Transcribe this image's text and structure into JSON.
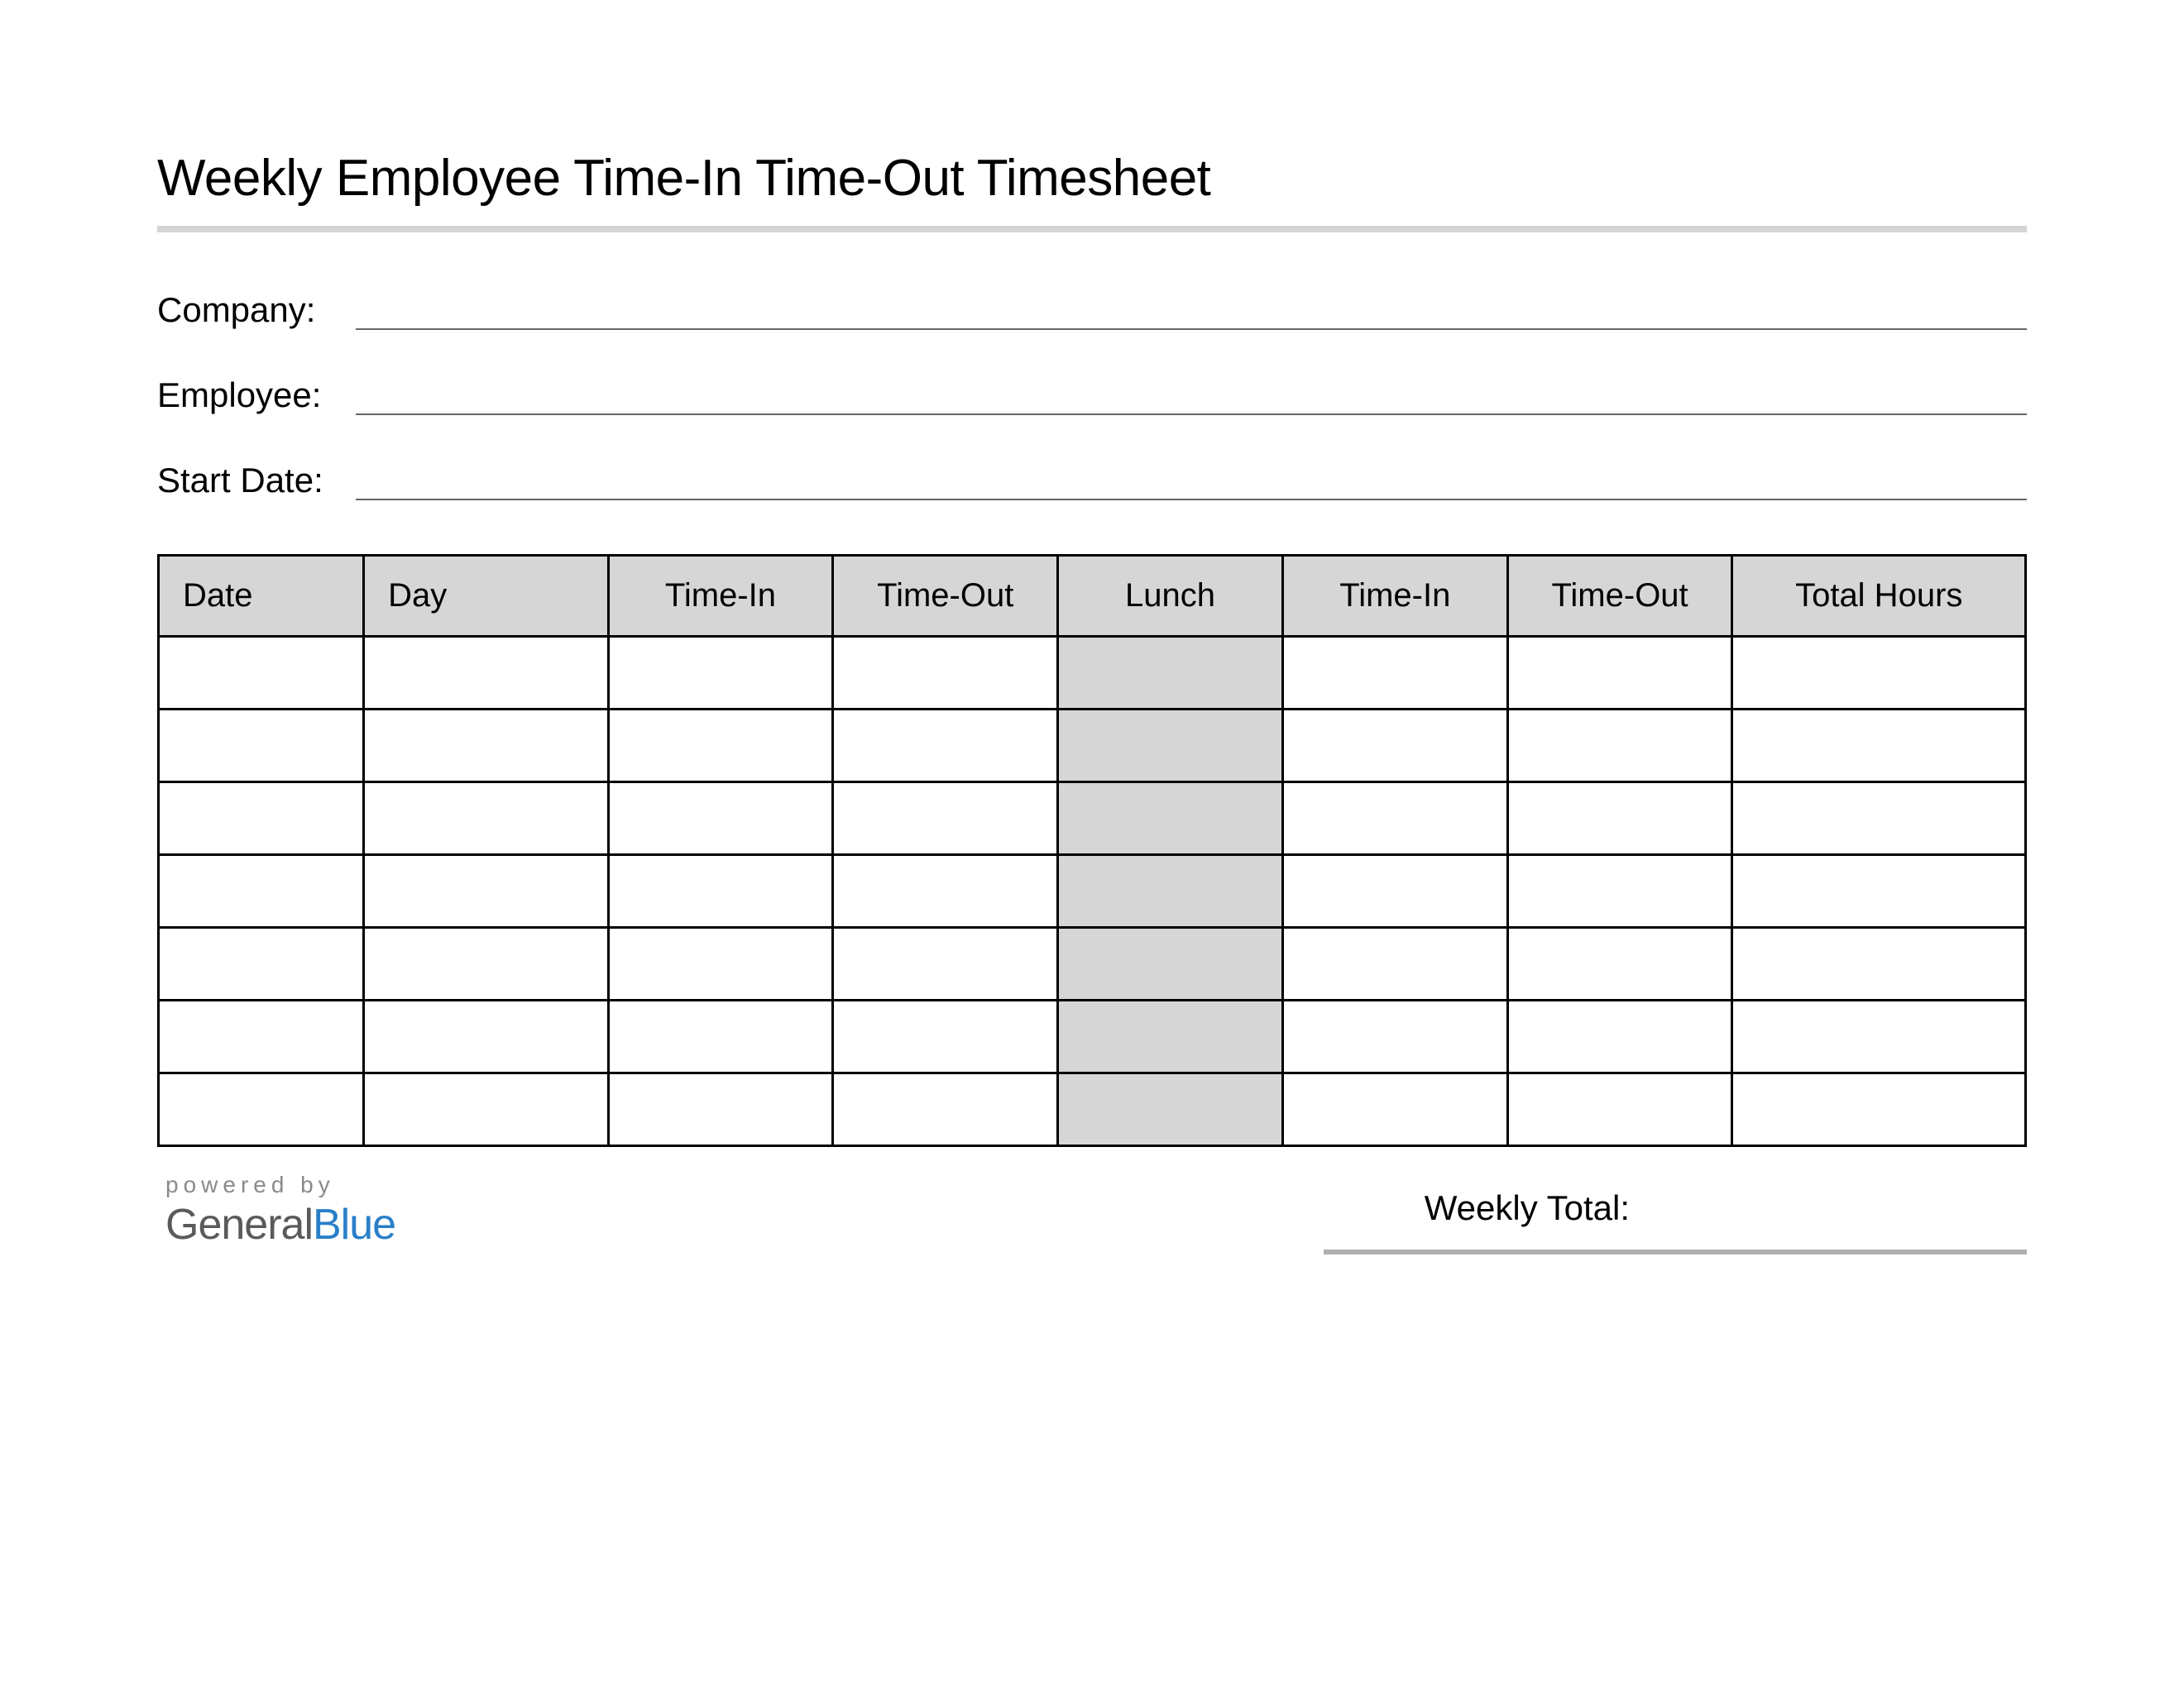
{
  "title": "Weekly Employee Time-In Time-Out Timesheet",
  "fields": {
    "company_label": "Company:",
    "employee_label": "Employee:",
    "start_date_label": "Start Date:",
    "company_value": "",
    "employee_value": "",
    "start_date_value": ""
  },
  "table": {
    "headers": [
      "Date",
      "Day",
      "Time-In",
      "Time-Out",
      "Lunch",
      "Time-In",
      "Time-Out",
      "Total Hours"
    ],
    "rows": [
      [
        "",
        "",
        "",
        "",
        "",
        "",
        "",
        ""
      ],
      [
        "",
        "",
        "",
        "",
        "",
        "",
        "",
        ""
      ],
      [
        "",
        "",
        "",
        "",
        "",
        "",
        "",
        ""
      ],
      [
        "",
        "",
        "",
        "",
        "",
        "",
        "",
        ""
      ],
      [
        "",
        "",
        "",
        "",
        "",
        "",
        "",
        ""
      ],
      [
        "",
        "",
        "",
        "",
        "",
        "",
        "",
        ""
      ],
      [
        "",
        "",
        "",
        "",
        "",
        "",
        "",
        ""
      ]
    ]
  },
  "footer": {
    "powered_by": "powered by",
    "brand_first": "General",
    "brand_second": "Blue",
    "weekly_total_label": "Weekly Total:",
    "weekly_total_value": ""
  }
}
